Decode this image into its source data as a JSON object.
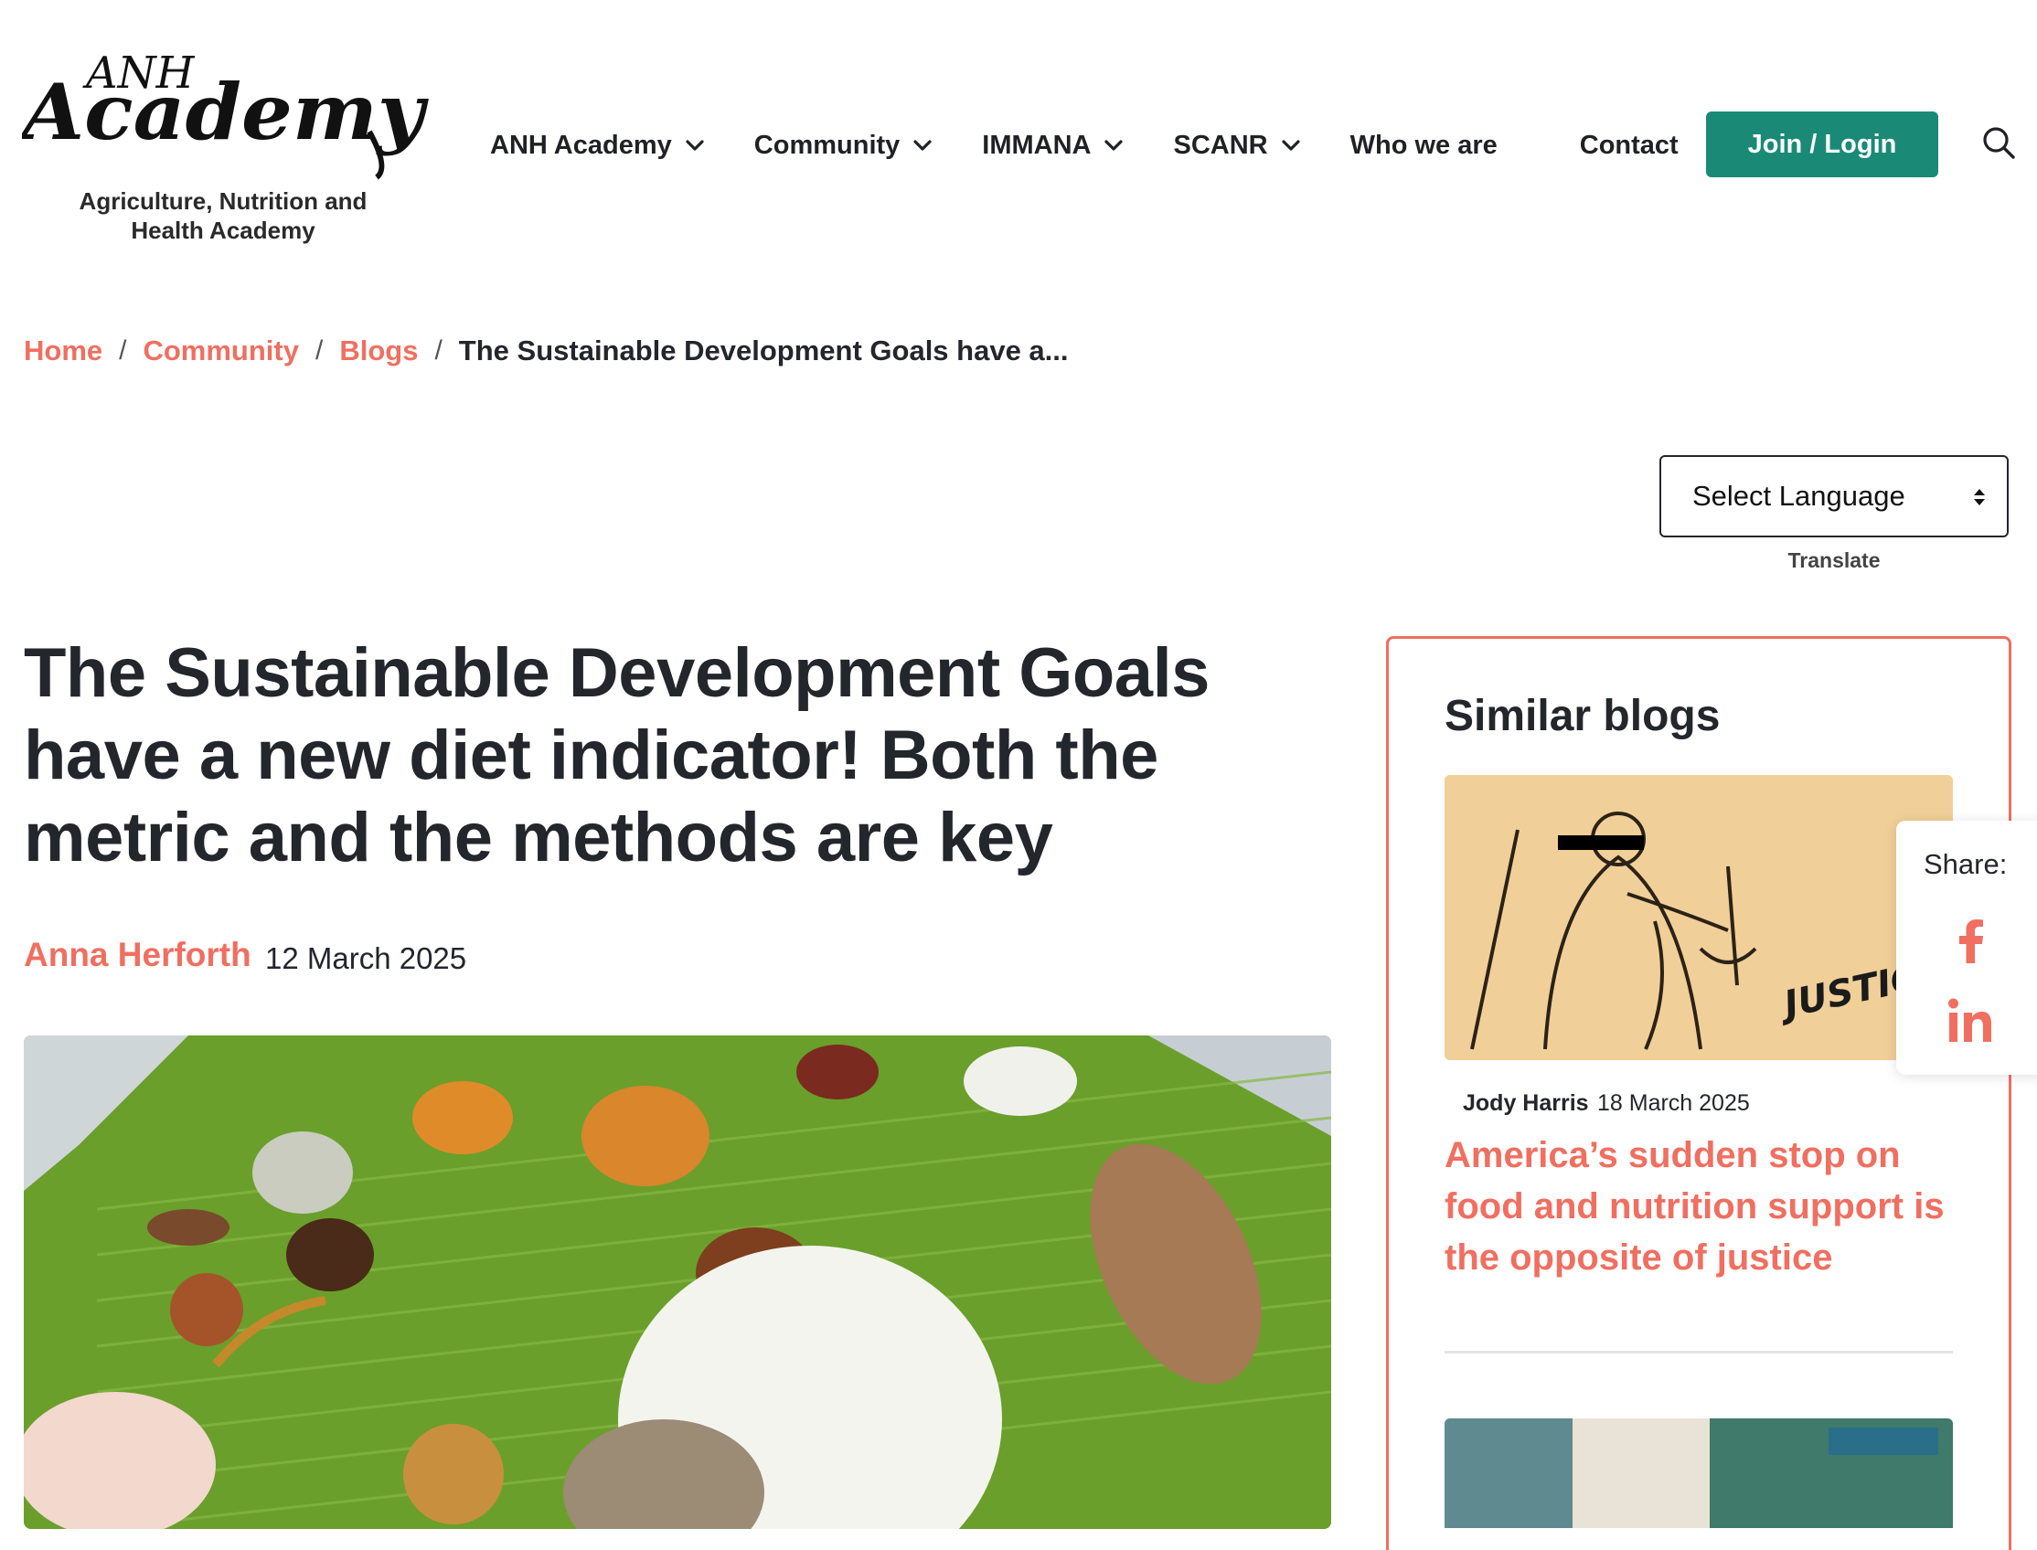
{
  "logo": {
    "script_top": "ANH",
    "script_main": "Academy",
    "subtitle_line1": "Agriculture, Nutrition and",
    "subtitle_line2": "Health Academy"
  },
  "nav": {
    "items": [
      {
        "label": "ANH Academy",
        "has_dropdown": true
      },
      {
        "label": "Community",
        "has_dropdown": true
      },
      {
        "label": "IMMANA",
        "has_dropdown": true
      },
      {
        "label": "SCANR",
        "has_dropdown": true
      },
      {
        "label": "Who we are",
        "has_dropdown": false
      },
      {
        "label": "Contact",
        "has_dropdown": false
      }
    ],
    "join_label": "Join / Login",
    "search_icon": "search-icon"
  },
  "breadcrumb": {
    "items": [
      "Home",
      "Community",
      "Blogs"
    ],
    "separator": "/",
    "current": "The Sustainable Development Goals have a..."
  },
  "language": {
    "selected": "Select Language",
    "caption": "Translate"
  },
  "article": {
    "title": "The Sustainable Development Goals have a new diet indicator! Both the metric and the methods are key",
    "author": "Anna Herforth",
    "date": "12 March 2025"
  },
  "sidebar": {
    "heading": "Similar blogs",
    "posts": [
      {
        "author": "Jody Harris",
        "date": "18 March 2025",
        "title": "America’s sudden stop on food and nutrition support is the opposite of justice",
        "image_text": "JUSTICE FOR A"
      }
    ]
  },
  "share": {
    "label": "Share:",
    "icons": [
      "facebook-icon",
      "linkedin-icon"
    ]
  },
  "colors": {
    "accent_coral": "#f06f60",
    "brand_green": "#1a8a77",
    "text_dark": "#23262b"
  }
}
